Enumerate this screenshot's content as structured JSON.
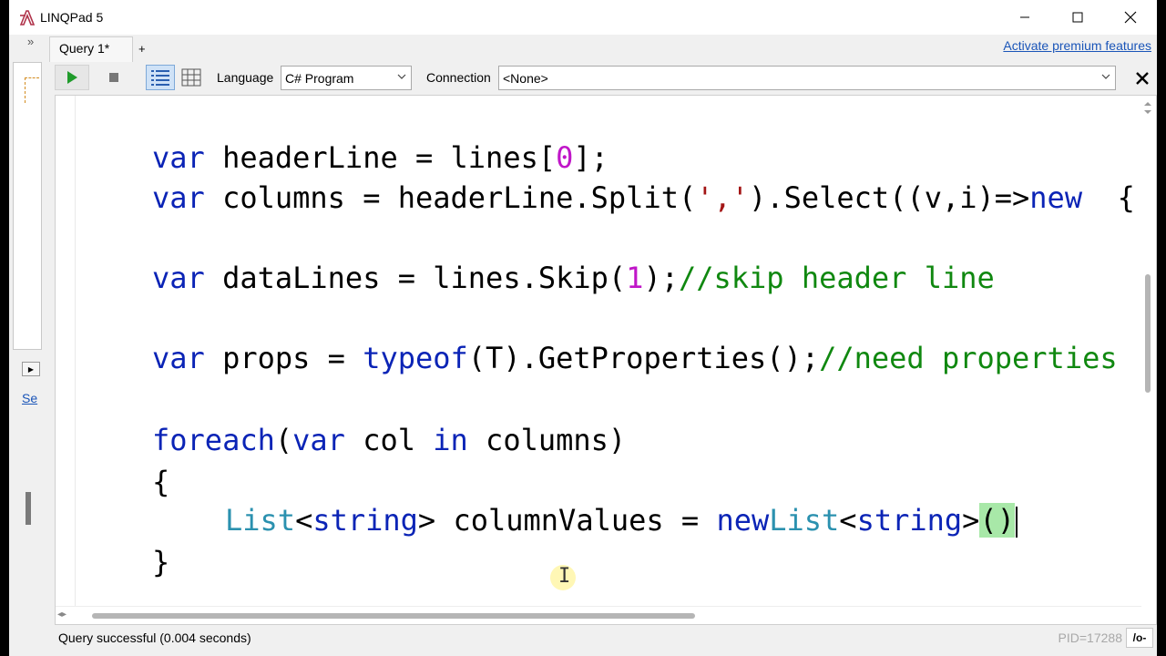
{
  "window": {
    "title": "LINQPad 5",
    "controls": {
      "minimize": "minimize-icon",
      "maximize": "maximize-icon",
      "close": "close-icon"
    }
  },
  "tabs": {
    "collapse": "»",
    "items": [
      {
        "label": "Query 1*"
      }
    ],
    "add": "+",
    "premium_link": "Activate premium features"
  },
  "sidebar": {
    "link_text": "Se",
    "arrow": "▶"
  },
  "toolbar": {
    "language_label": "Language",
    "language_value": "C# Program",
    "connection_label": "Connection",
    "connection_value": "<None>"
  },
  "editor": {
    "lines": [
      {
        "parts": [
          [
            "kw",
            "var"
          ],
          [
            "",
            "headerLine = lines["
          ],
          [
            "num",
            "0"
          ],
          [
            "",
            "];"
          ]
        ]
      },
      {
        "parts": [
          [
            "kw",
            "var"
          ],
          [
            "",
            "columns = headerLine.Split("
          ],
          [
            "str",
            "','"
          ],
          [
            "",
            ").Select((v,i)=>"
          ],
          [
            "kw",
            "new"
          ],
          [
            "",
            " {"
          ]
        ]
      },
      {
        "parts": [
          [
            "kw",
            "var"
          ],
          [
            "",
            "dataLines = lines.Skip("
          ],
          [
            "num",
            "1"
          ],
          [
            "",
            ");"
          ],
          [
            "cm",
            "//skip header line"
          ]
        ]
      },
      {
        "parts": [
          [
            "kw",
            "var"
          ],
          [
            "",
            "props = "
          ],
          [
            "kw",
            "typeof"
          ],
          [
            "",
            "(T).GetProperties();"
          ],
          [
            "cm",
            "//need properties"
          ]
        ]
      },
      {
        "parts": [
          [
            "kw",
            "foreach"
          ],
          [
            "",
            "("
          ],
          [
            "kw",
            "var"
          ],
          [
            "",
            "col "
          ],
          [
            "kw",
            "in"
          ],
          [
            "",
            "columns)"
          ]
        ]
      },
      {
        "parts": [
          [
            "",
            "{"
          ]
        ]
      },
      {
        "parts": [
          [
            "ty",
            "List"
          ],
          [
            "",
            "<"
          ],
          [
            "kw",
            "string"
          ],
          [
            "",
            "> columnValues = "
          ],
          [
            "kw",
            "new"
          ],
          [
            "",
            ""
          ],
          [
            "ty",
            "List"
          ],
          [
            "",
            "<"
          ],
          [
            "kw",
            "string"
          ],
          [
            "",
            ">"
          ],
          [
            "hl",
            "()"
          ]
        ]
      },
      {
        "parts": [
          [
            "",
            "}"
          ]
        ]
      }
    ]
  },
  "status": {
    "message": "Query successful  (0.004 seconds)",
    "pid": "PID=17288",
    "ro_label": "/o-"
  },
  "colors": {
    "keyword": "#0b24b6",
    "type": "#2b91af",
    "number": "#c016c8",
    "string": "#a31515",
    "comment": "#108810",
    "link": "#1a55b8"
  }
}
